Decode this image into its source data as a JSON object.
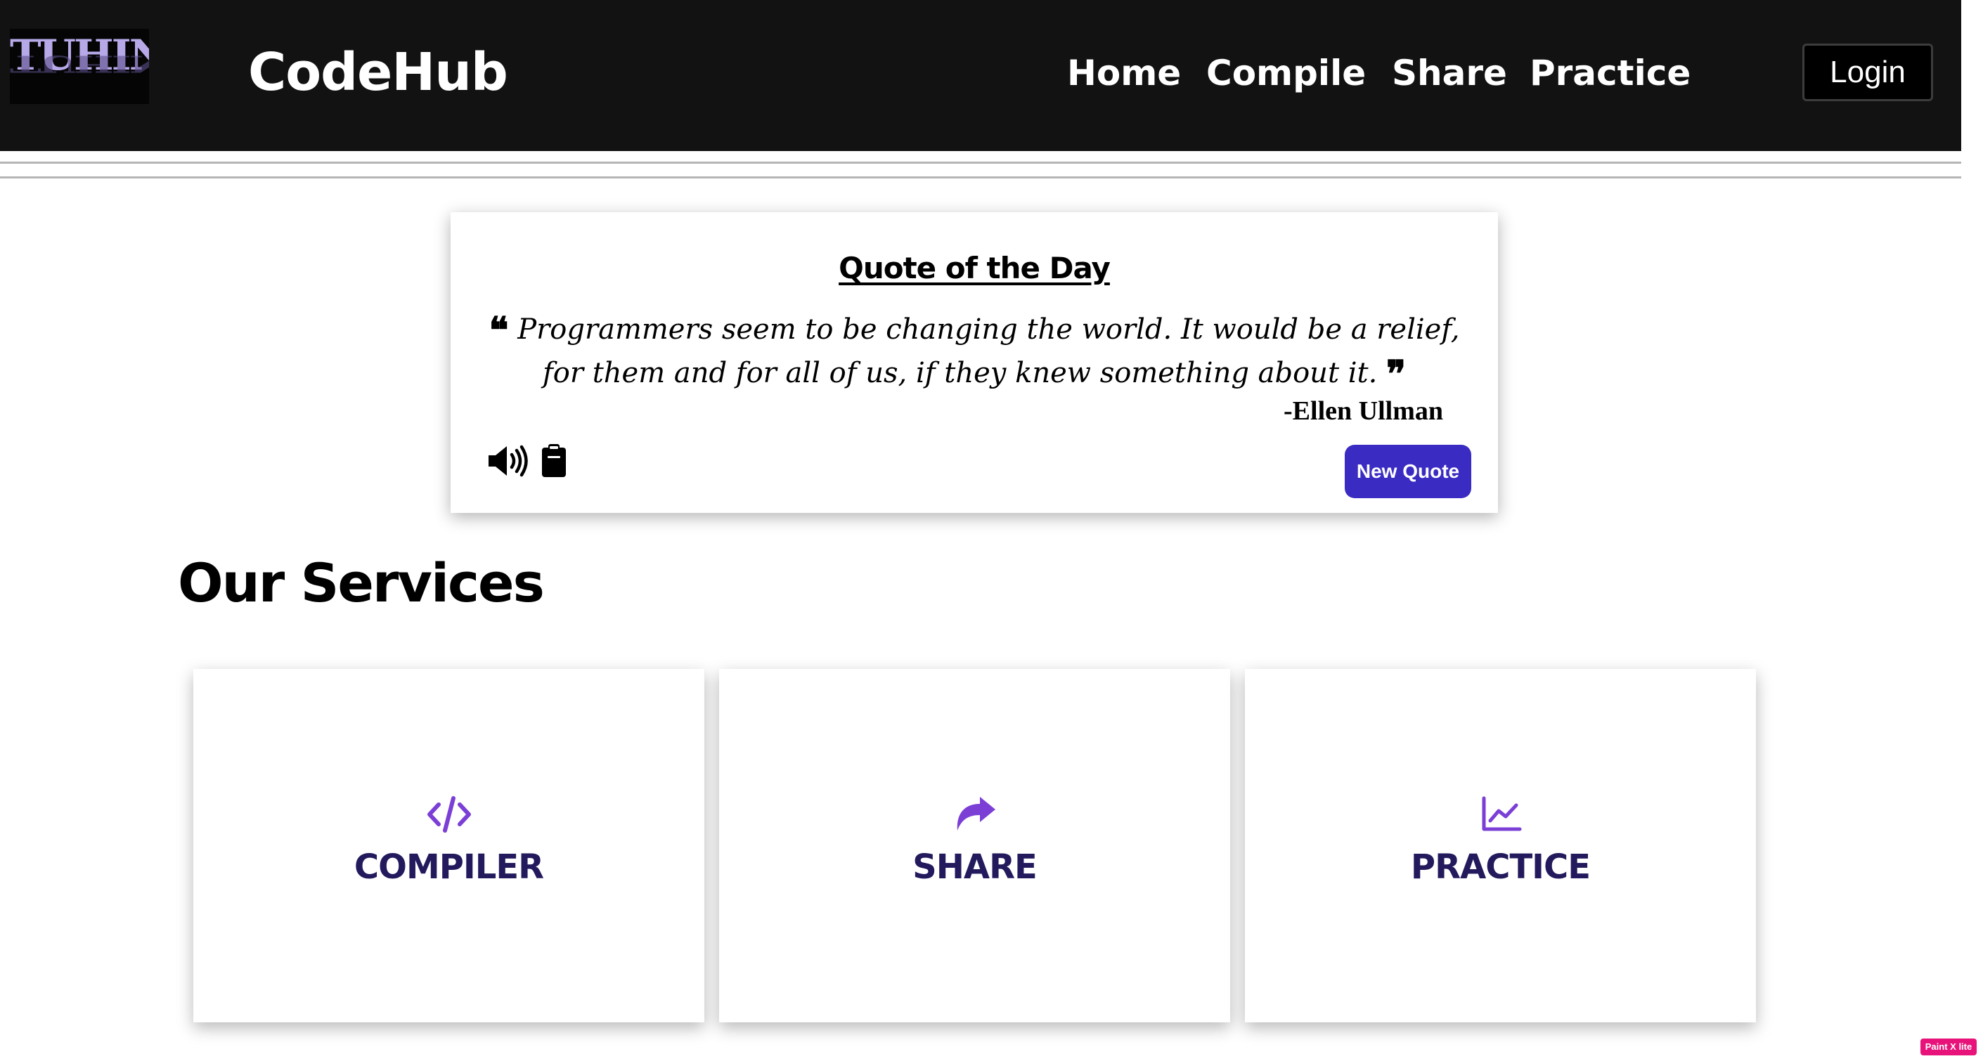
{
  "colors": {
    "navbar_bg": "#121212",
    "accent_purple": "#7b3fd6",
    "button_blue": "#3a2cc2",
    "service_label": "#221a5c",
    "badge_pink": "#e8137a"
  },
  "header": {
    "logo_text": "TUHIN",
    "brand": "CodeHub",
    "nav": [
      "Home",
      "Compile",
      "Share",
      "Practice"
    ],
    "login_label": "Login"
  },
  "quote": {
    "title": "Quote of the Day",
    "open_mark": "❝",
    "text": "Programmers seem to be changing the world. It would be a relief, for them and for all of us, if they knew something about it.",
    "close_mark": "❞",
    "author": "-Ellen Ullman",
    "speak_icon": "speaker-icon",
    "copy_icon": "clipboard-icon",
    "new_quote_label": "New Quote"
  },
  "services": {
    "heading": "Our Services",
    "cards": [
      {
        "label": "COMPILER",
        "icon": "code-icon"
      },
      {
        "label": "SHARE",
        "icon": "share-arrow-icon"
      },
      {
        "label": "PRACTICE",
        "icon": "line-chart-icon"
      }
    ]
  },
  "badge": {
    "text": "Paint X lite"
  }
}
